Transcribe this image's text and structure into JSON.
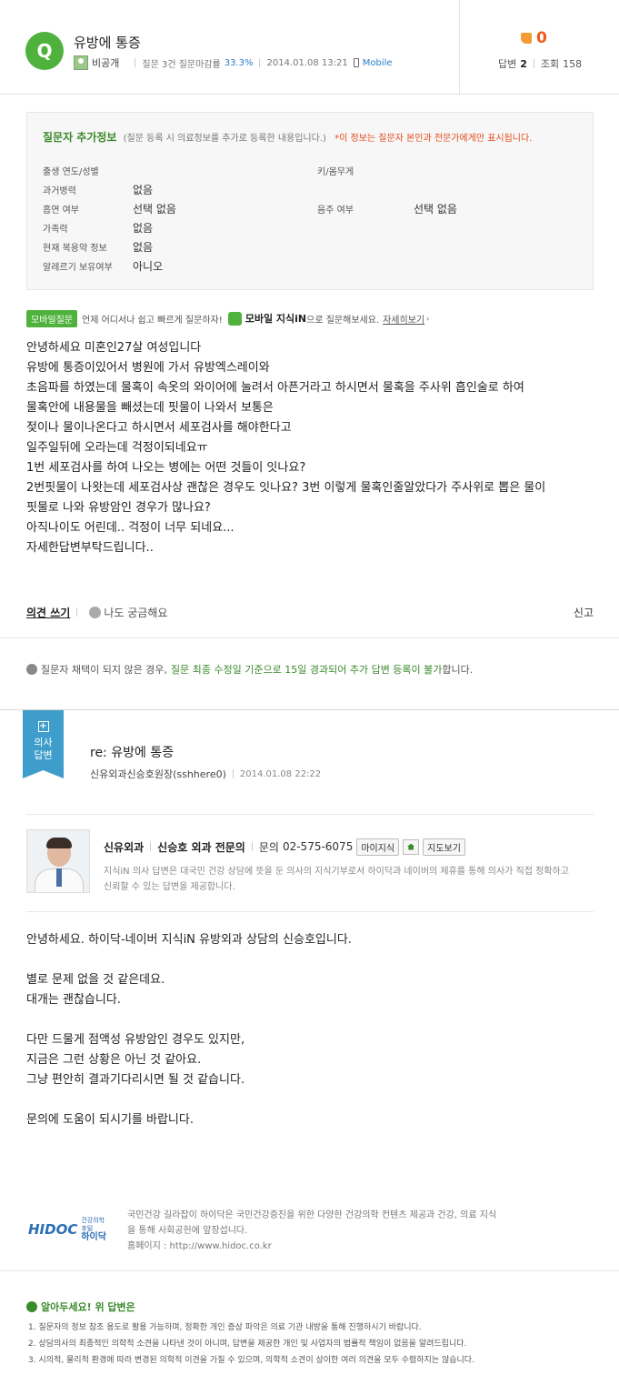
{
  "question": {
    "badge": "Q",
    "title": "유방에 통증",
    "nickname": "비공개",
    "stats_text": "질문 3건 질문마감률",
    "close_rate": "33.3%",
    "datetime": "2014.01.08 13:21",
    "device": "Mobile",
    "like_count": "0",
    "answers_label": "답변",
    "answers_count": "2",
    "views_label": "조회",
    "views_count": "158"
  },
  "extra_info": {
    "title": "질문자 추가정보",
    "desc": "(질문 등록 시 의료정보를 추가로 등록한 내용입니다.)",
    "warning": "*이 정보는 질문자 본인과 전문가에게만 표시됩니다.",
    "rows": [
      {
        "label": "출생 연도/성별",
        "value": ""
      },
      {
        "label": "과거병력",
        "value": "없음"
      },
      {
        "label": "흡연 여부",
        "value": "선택 없음"
      },
      {
        "label": "가족력",
        "value": "없음"
      },
      {
        "label": "현재 복용약 정보",
        "value": "없음"
      },
      {
        "label": "알레르기 보유여부",
        "value": "아니오"
      }
    ],
    "right_rows": [
      {
        "label": "키/몸무게",
        "value": ""
      },
      {
        "label": "음주 여부",
        "value": "선택 없음"
      }
    ]
  },
  "promo": {
    "tag": "모바일질문",
    "text": "언제 어디서나 쉽고 빠르게 질문하자!",
    "app": "모바일 지식iN",
    "text2": "으로 질문해보세요.",
    "link": "자세히보기"
  },
  "question_body": [
    "안녕하세요 미혼인27살 여성입니다",
    "유방에 통증이있어서 병원에 가서 유방엑스레이와",
    "초음파를 하였는데 물혹이 속옷의 와이어에 눌려서 아픈거라고 하시면서 물혹을 주사위 흡인술로 하여",
    "물혹안에 내용물을 빼셨는데 핏물이 나와서 보통은",
    "젖이나 물이나온다고 하시면서 세포검사를 해야한다고",
    "일주일뒤에 오라는데 걱정이되네요ㅠ",
    "1번 세포검사를 하여 나오는 병에는 어떤 것들이 잇나요?",
    "2번핏물이 나왓는데 세포검사상 괜찮은 경우도 잇나요? 3번 이렇게 물혹인줄알았다가 주사위로 뽑은 물이",
    "핏물로 나와 유방암인 경우가 많나요?",
    "아직나이도 어린데.. 걱정이 너무 되네요...",
    "자세한답변부탁드립니다.."
  ],
  "actions": {
    "opinion": "의견 쓰기",
    "curious": "나도 궁금해요",
    "report": "신고"
  },
  "notice": {
    "prefix": "질문자 채택이 되지 않은 경우,",
    "highlight": "질문 최종 수정일 기준으로 15일 경과되어 추가 답변 등록이 불가",
    "suffix": "합니다."
  },
  "answer": {
    "ribbon_top": "의사",
    "ribbon_bottom": "답변",
    "title": "re: 유방에 통증",
    "author": "신유외과신승호원장(sshhere0)",
    "datetime": "2014.01.08 22:22",
    "clinic": "신유외과",
    "doctor": "신승호 외과 전문의",
    "phone_label": "문의",
    "phone": "02-575-6075",
    "btn_site": "마이지식",
    "btn_map": "지도보기",
    "desc": "지식iN 의사 답변은 대국민 건강 상담에 뜻을 둔 의사의 지식기부로서 하이닥과 네이버의 제휴를 통해 의사가 직접 정확하고 신뢰할 수 있는 답변을 제공합니다.",
    "body": [
      "안녕하세요. 하이닥-네이버 지식iN 유방외과 상담의 신승호입니다.",
      "",
      "별로 문제 없을 것 같은데요.",
      "대개는 괜찮습니다.",
      "",
      "다만 드물게 점액성 유방암인 경우도 있지만,",
      "지금은 그런 상황은 아닌 것 같아요.",
      "그냥 편안히 결과기다리시면 될 것 같습니다.",
      "",
      "문의에 도움이 되시기를 바랍니다."
    ]
  },
  "hidoc": {
    "logo": "HIDOC",
    "logo_sub1": "건강의학포털",
    "logo_sub2": "하이닥",
    "text": "국민건강 길라잡이 하이닥은 국민건강증진을 위한 다양한 건강의학 컨텐츠 제공과 건강, 의료 지식을 통해 사회공헌에 앞장섭니다.",
    "homepage": "홈페이지 : http://www.hidoc.co.kr"
  },
  "notes": {
    "title": "알아두세요! 위 답변은",
    "items": [
      "1. 질문자의 정보 참조 용도로 활용 가능하며, 정확한 개인 증상 파악은 의료 기관 내방을 통해 진행하시기 바랍니다.",
      "2. 상담의사의 최종적인 의학적 소견을 나타낸 것이 아니며, 답변을 제공한 개인 및 사업자의 법률적 책임이 없음을 알려드립니다.",
      "3. 시의적, 물리적 환경에 따라 변경된 의학적 이견을 가질 수 있으며, 의학적 소견이 상이한 여러 의견을 모두 수렴하지는 않습니다."
    ]
  }
}
